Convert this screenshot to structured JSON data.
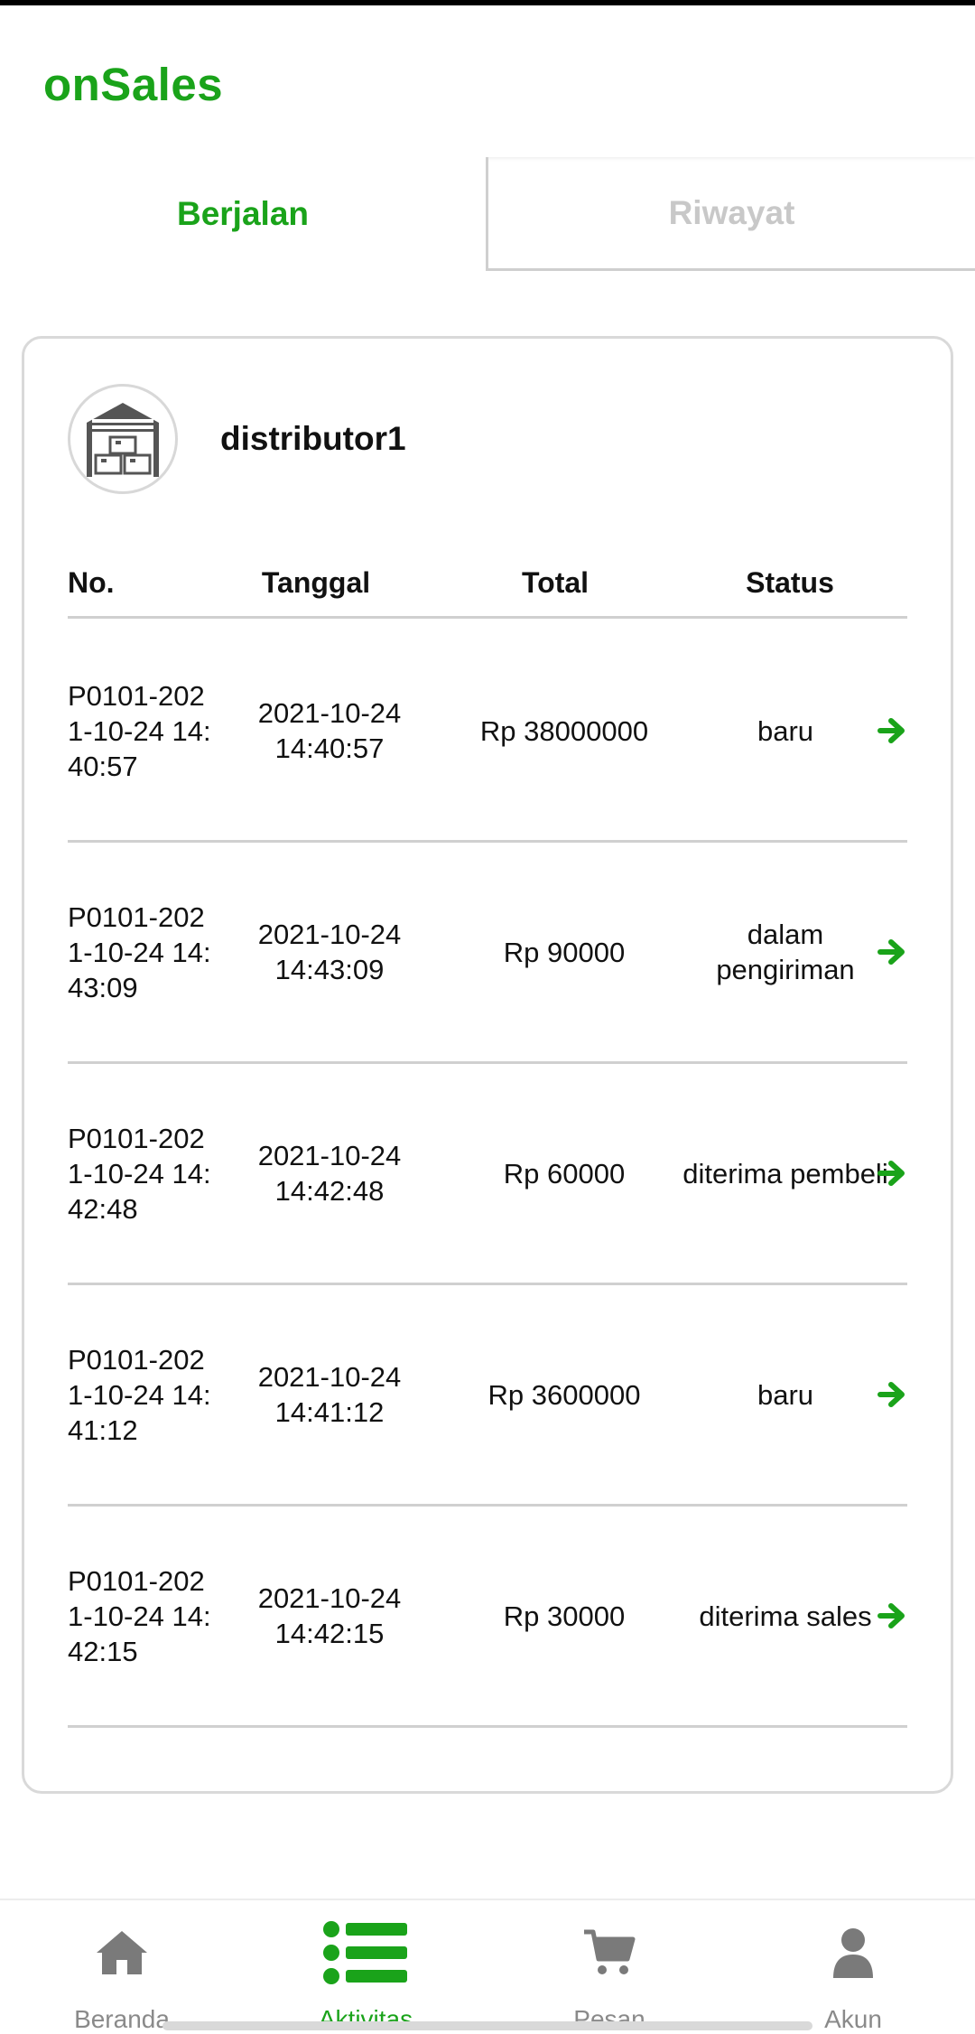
{
  "header": {
    "title": "onSales"
  },
  "tabs": [
    {
      "label": "Berjalan",
      "active": true
    },
    {
      "label": "Riwayat",
      "active": false
    }
  ],
  "distributor": {
    "name": "distributor1",
    "icon": "warehouse-icon"
  },
  "table": {
    "headers": {
      "no": "No.",
      "date": "Tanggal",
      "total": "Total",
      "status": "Status"
    },
    "rows": [
      {
        "no": "P0101-2021-10-24 14:40:57",
        "date": "2021-10-24 14:40:57",
        "total": "Rp 38000000",
        "status": "baru"
      },
      {
        "no": "P0101-2021-10-24 14:43:09",
        "date": "2021-10-24 14:43:09",
        "total": "Rp 90000",
        "status": "dalam pengiriman"
      },
      {
        "no": "P0101-2021-10-24 14:42:48",
        "date": "2021-10-24 14:42:48",
        "total": "Rp 60000",
        "status": "diterima pembeli"
      },
      {
        "no": "P0101-2021-10-24 14:41:12",
        "date": "2021-10-24 14:41:12",
        "total": "Rp 3600000",
        "status": "baru"
      },
      {
        "no": "P0101-2021-10-24 14:42:15",
        "date": "2021-10-24 14:42:15",
        "total": "Rp 30000",
        "status": "diterima sales"
      }
    ]
  },
  "bottom_nav": [
    {
      "label": "Beranda",
      "icon": "home-icon",
      "active": false
    },
    {
      "label": "Aktivitas",
      "icon": "list-icon",
      "active": true
    },
    {
      "label": "Pesan",
      "icon": "cart-icon",
      "active": false
    },
    {
      "label": "Akun",
      "icon": "user-icon",
      "active": false
    }
  ],
  "colors": {
    "accent": "#1aa31a",
    "inactive": "#c8c8c8",
    "border": "#d0d0d0"
  }
}
